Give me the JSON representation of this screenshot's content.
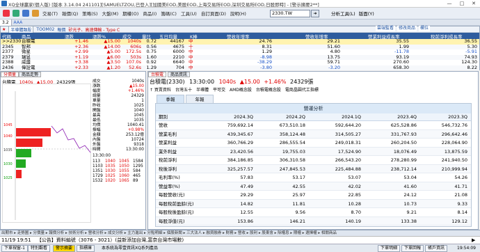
{
  "window": {
    "title": "XQ全球贏家(個人版) [版本 3.14.04 241101][SAMUELTZOU,已登入][加國美EOD,美股EOD,上海交易所EOD,深圳交易所EOD,日股即時] - [警示摘要2**]",
    "controls": [
      "—",
      "□",
      "✕"
    ]
  },
  "menubar": {
    "items": [
      "交易(T)",
      "報價(Q)",
      "策略(S)",
      "大盤(M)",
      "期權(O)",
      "商品(I)",
      "籌碼(C)",
      "工具(U)",
      "自訂頁面(D)",
      "說明(H)"
    ],
    "code_value": "2330.TW",
    "go_label": "➜",
    "right_items": [
      "分析工具(L)",
      "版面(Y)"
    ]
  },
  "top_tabs": [
    "3.2",
    "AAA"
  ],
  "watchlist": {
    "label": "矽光子、高速傳輸 - Type C",
    "toolbar": [
      "★",
      "半導體類股",
      "TOOM02",
      "報價"
    ],
    "actions": [
      "雲端監看",
      "修改商品",
      "欄位"
    ],
    "columns": [
      "代碼",
      "商品",
      "漲跌",
      "漲跌%",
      "成交",
      "量比",
      "五日均量",
      "K棒",
      "營收年增率",
      "營收年增率",
      "營業利益成長率",
      "稅前淨利成長率"
    ],
    "rows": [
      {
        "code": ">>2330",
        "name": "台積電",
        "chg": "+1.46",
        "pct": "▲15.00",
        "price": "1040s",
        "ratio": "0.72",
        "avgvol": "44167",
        "k": "中",
        "c1": "24.76",
        "c2": "29.21",
        "c3": "35.55",
        "c4": "36.55",
        "selected": true
      },
      {
        "code": "2345",
        "name": "智邦",
        "chg": "+2.36",
        "pct": "▲14.00",
        "price": "606s",
        "ratio": "0.56",
        "avgvol": "4675",
        "k": "十",
        "c1": "8.31",
        "c2": "51.60",
        "c3": "1.99",
        "c4": "5.30",
        "selected": false
      },
      {
        "code": "2377",
        "name": "微星",
        "chg": "+2.99",
        "pct": "▲5.00",
        "price": "172.5s",
        "ratio": "0.75",
        "avgvol": "6000",
        "k": "中",
        "c1": "1.29",
        "c2": "4.80",
        "c3": "-11.78",
        "c4": "-5.91",
        "selected": false
      },
      {
        "code": "2379",
        "name": "瑞昱",
        "chg": "+1.19",
        "pct": "▲6.00",
        "price": "503s",
        "ratio": "1.60",
        "avgvol": "2210",
        "k": "中",
        "c1": "-8.98",
        "c2": "13.75",
        "c3": "93.19",
        "c4": "74.93",
        "selected": false
      },
      {
        "code": "2388",
        "name": "威盛",
        "chg": "+3.38",
        "pct": "▲3.50",
        "price": "107.0s",
        "ratio": "0.92",
        "avgvol": "6640",
        "k": "中",
        "c1": "-38.29",
        "c2": "59.71",
        "c3": "270.60",
        "c4": "124.30",
        "selected": false
      },
      {
        "code": "2436",
        "name": "偉詮電",
        "chg": "+2.33",
        "pct": "▲1.20",
        "price": "52.6s",
        "ratio": "1.29",
        "avgvol": "704",
        "k": "中",
        "c1": "-3.80",
        "c2": "-3.20",
        "c3": "658.30",
        "c4": "8.22",
        "selected": false
      }
    ]
  },
  "mini": {
    "tabs": [
      "分價量",
      "商品走勢"
    ],
    "header_code": "台積電",
    "header_price": "1040s",
    "header_chg": "▲15.00",
    "header_vol": "24329張",
    "side": [
      {
        "l": "成交",
        "v": "1040s"
      },
      {
        "l": "漲跌",
        "v": "▲15.00"
      },
      {
        "l": "幅度",
        "v": "+1.46%"
      },
      {
        "l": "總量",
        "v": "24329"
      },
      {
        "l": "單量",
        "v": "1"
      },
      {
        "l": "昨收",
        "v": "1025"
      },
      {
        "l": "開盤",
        "v": "1040"
      },
      {
        "l": "最高",
        "v": "1045"
      },
      {
        "l": "最低",
        "v": "1035"
      },
      {
        "l": "均價",
        "v": "1040.41"
      },
      {
        "l": "振幅",
        "v": "+0.98%"
      },
      {
        "l": "金額",
        "v": "253.12億"
      },
      {
        "l": "內盤",
        "v": "10724"
      },
      {
        "l": "外盤",
        "v": "9318"
      },
      {
        "l": "時間",
        "v": "13:30:00"
      }
    ],
    "time": "13:30:00",
    "book": [
      {
        "bv": "113",
        "b": "1040",
        "a": "1045",
        "av": "1584"
      },
      {
        "bv": "1103",
        "b": "1035",
        "a": "1050",
        "av": "1295"
      },
      {
        "bv": "1351",
        "b": "1030",
        "a": "1055",
        "av": "584"
      },
      {
        "bv": "1729",
        "b": "1025",
        "a": "1060",
        "av": "465"
      },
      {
        "bv": "1532",
        "b": "1020",
        "a": "1065",
        "av": "89"
      }
    ],
    "yaxis": [
      "1045",
      "1040",
      "1035",
      "1030",
      "1025"
    ]
  },
  "analysis": {
    "header_tabs": [
      "台積電",
      "商品資訊"
    ],
    "title_code": "台積電(2330)",
    "title_time": "13:30:00",
    "title_price": "1040s",
    "title_chg": "▲15.00",
    "title_pct": "+1.46%",
    "title_vol": "24329張",
    "links": [
      "↑ 買賣資料",
      "台灣五十",
      "半導體",
      "平可交",
      "AMD概念股",
      "台積電概念股",
      "電商晶圓代工指標"
    ],
    "tabs": [
      "季報",
      "年報"
    ],
    "box_title": "營運分析",
    "columns": [
      "期別",
      "2024.3Q",
      "2024.2Q",
      "2024.1Q",
      "2023.4Q",
      "2023.3Q"
    ],
    "rows": [
      [
        "營收",
        "759,692.14",
        "673,510.18",
        "592,644.20",
        "625,528.86",
        "546,732.76"
      ],
      [
        "營業毛利",
        "439,345.67",
        "358,124.48",
        "314,505.27",
        "331,767.93",
        "296,642.46"
      ],
      [
        "營業利益",
        "360,766.29",
        "286,555.54",
        "249,018.31",
        "260,204.50",
        "228,064.90"
      ],
      [
        "業外利益",
        "23,420.56",
        "19,755.03",
        "17,524.90",
        "18,076.49",
        "13,875.59"
      ],
      [
        "稅前淨利",
        "384,186.85",
        "306,310.58",
        "266,543.20",
        "278,280.99",
        "241,940.50"
      ],
      [
        "稅後淨利",
        "325,257.57",
        "247,845.53",
        "225,484.88",
        "238,712.14",
        "210,999.94"
      ],
      [
        "毛利率(%)",
        "57.83",
        "53.17",
        "53.07",
        "53.04",
        "54.26"
      ],
      [
        "營益率(%)",
        "47.49",
        "42.55",
        "42.02",
        "41.60",
        "41.71"
      ],
      [
        "每股營收(元)",
        "29.29",
        "25.97",
        "22.85",
        "24.12",
        "21.08"
      ],
      [
        "每股稅前盈餘(元)",
        "14.82",
        "11.81",
        "10.28",
        "10.73",
        "9.33"
      ],
      [
        "每股稅後盈餘(元)",
        "12.55",
        "9.56",
        "8.70",
        "9.21",
        "8.14"
      ],
      [
        "每股淨值(元)",
        "153.86",
        "146.21",
        "140.19",
        "133.38",
        "129.12"
      ]
    ]
  },
  "bottom_tabs": "出期市 ▸ 走勢圖 ▸ 分價量 ▸ 報價分析 ▸ 技術分析 ▸ 營收分析 ▸ 成交分析 ▸ 主力進出 ▸ 分點明細 ▸ 個股新聞 ▸ 三大法人 ▸ 融資融券 ▸ 財務 ▸ 營收 ▸ 股利 ▸ 股東會 ▸ 除權息 ▸ 期權 ▸ 選擇權 ▸ 相關商品",
  "ticker": {
    "time": "11/19 19:51",
    "text": "【公告】資料編號（3076 - 3021）(益新添加台灣,富奈台灣市場數)",
    "more": "▶"
  },
  "status": {
    "left_buttons": [
      "下單視窗-1",
      "特別觀看",
      "警示摘要",
      "指標庫"
    ],
    "left_text": "本系統為零壹資訊XQ系列產品",
    "right_buttons": [
      "下單明細",
      "下單回報",
      "帳戶資訊"
    ],
    "clock": "19:54:09"
  }
}
